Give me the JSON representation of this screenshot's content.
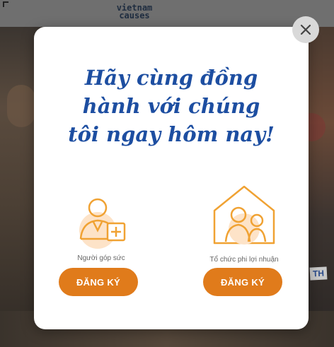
{
  "background": {
    "logo_text": "vietnam\ncauses",
    "side_text": "TH"
  },
  "modal": {
    "headline_lines": [
      "Hãy cùng đồng",
      "hành với chúng",
      "tôi ngay hôm nay!"
    ],
    "options": [
      {
        "label": "Người góp sức",
        "button": "ĐĂNG KÝ",
        "icon": "contributor-add-person-icon"
      },
      {
        "label": "Tổ chức phi lợi nhuận",
        "button": "ĐĂNG KÝ",
        "icon": "nonprofit-house-people-icon"
      }
    ],
    "close_icon": "close-icon"
  },
  "colors": {
    "headline": "#1d4ea1",
    "accent": "#e07b1b",
    "icon_fill": "#fde3c8",
    "icon_stroke": "#f0a233"
  }
}
